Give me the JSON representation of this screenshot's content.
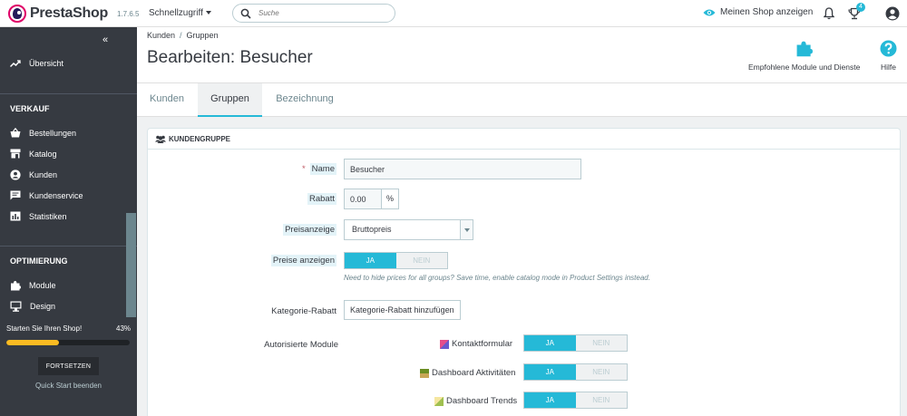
{
  "header": {
    "logo_text": "PrestaShop",
    "version": "1.7.6.5",
    "quick_access": "Schnellzugriff",
    "search_placeholder": "Suche",
    "view_shop": "Meinen Shop anzeigen",
    "cart_badge": "4"
  },
  "sidebar": {
    "overview": "Übersicht",
    "section_sell": "VERKAUF",
    "sell_items": [
      "Bestellungen",
      "Katalog",
      "Kunden",
      "Kundenservice",
      "Statistiken"
    ],
    "section_improve": "OPTIMIERUNG",
    "improve_items": [
      "Module",
      "Design"
    ],
    "onboarding": {
      "title": "Starten Sie Ihren Shop!",
      "percent_label": "43%",
      "progress": 0.43,
      "resume": "FORTSETZEN",
      "end": "Quick Start beenden"
    }
  },
  "page": {
    "breadcrumb": [
      "Kunden",
      "Gruppen"
    ],
    "title": "Bearbeiten: Besucher",
    "toolbar": {
      "modules": "Empfohlene Module und Dienste",
      "help": "Hilfe"
    }
  },
  "tabs": [
    "Kunden",
    "Gruppen",
    "Bezeichnung"
  ],
  "form": {
    "panel_title": "KUNDENGRUPPE",
    "name_label": "Name",
    "name_value": "Besucher",
    "discount_label": "Rabatt",
    "discount_value": "0.00",
    "discount_unit": "%",
    "price_display_label": "Preisanzeige",
    "price_display_value": "Bruttopreis",
    "show_prices_label": "Preise anzeigen",
    "yes": "JA",
    "no": "NEIN",
    "show_prices_help": "Need to hide prices for all groups? Save time, enable catalog mode in Product Settings instead.",
    "category_discount_label": "Kategorie-Rabatt",
    "category_discount_button": "Kategorie-Rabatt hinzufügen",
    "authorized_modules_label": "Autorisierte Module",
    "modules": [
      "Kontaktformular",
      "Dashboard Aktivitäten",
      "Dashboard Trends"
    ]
  },
  "colors": {
    "accent": "#25b9d7",
    "sidebar": "#363a41",
    "progress": "#fbbb22",
    "brand": "#df0067"
  }
}
